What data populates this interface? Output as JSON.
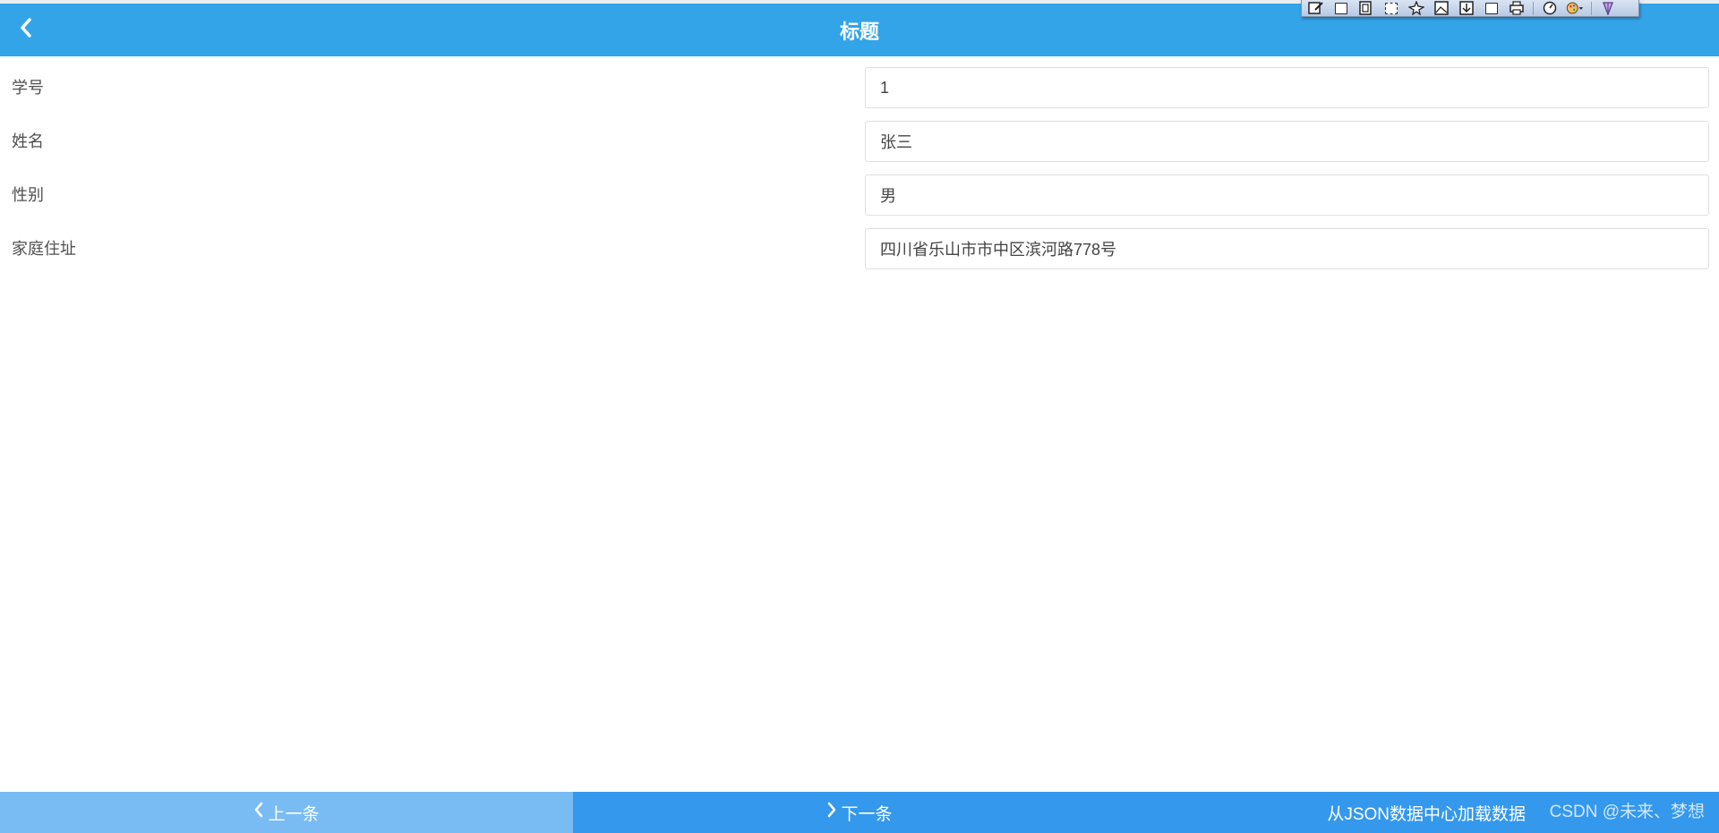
{
  "header": {
    "title": "标题",
    "back_icon": "chevron-left-icon",
    "background_color": "#33a4e8"
  },
  "toolbar": {
    "icons": [
      "edit-icon",
      "page-icon",
      "copy-icon",
      "page-icon",
      "pin-icon",
      "image-icon",
      "import-icon",
      "page-icon",
      "print-icon",
      "timer-icon",
      "palette-icon",
      "pen-icon"
    ]
  },
  "form": {
    "fields": [
      {
        "label": "学号",
        "value": "1"
      },
      {
        "label": "姓名",
        "value": "张三"
      },
      {
        "label": "性别",
        "value": "男"
      },
      {
        "label": "家庭住址",
        "value": "四川省乐山市市中区滨河路778号"
      }
    ]
  },
  "footer": {
    "prev_label": "上一条",
    "next_label": "下一条",
    "load_label": "从JSON数据中心加载数据",
    "watermark": "CSDN @未来、梦想",
    "prev_color": "#79bcf3",
    "next_color": "#3498ec"
  }
}
